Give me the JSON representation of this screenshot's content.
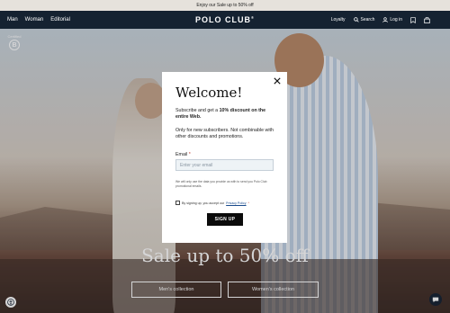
{
  "announcement": {
    "text": "Enjoy our Sale up to 50% off"
  },
  "nav": {
    "left_links": [
      "Man",
      "Woman",
      "Editorial"
    ],
    "logo": "POLO CLUB",
    "loyalty": "Loyalty",
    "search": "Search",
    "login": "Log in"
  },
  "badge": {
    "top": "Certified",
    "letter": "B"
  },
  "hero": {
    "headline": "Sale up to 50% off",
    "men_button": "Men's collection",
    "women_button": "Women's collection"
  },
  "modal": {
    "title": "Welcome!",
    "offer_prefix": "Subscribe and get a ",
    "offer_bold": "10% discount on the entire Web.",
    "note": "Only for new subscribers. Not combinable with other discounts and promotions.",
    "email_label": "Email",
    "email_required": "*",
    "email_placeholder": "Enter your email",
    "legal": "We will only use the data you provide us with to send you Polo Club promotional emails.",
    "consent_prefix": "By signing up, you accept our ",
    "consent_link": "Privacy Policy",
    "consent_required": "*",
    "signup_button": "SIGN UP"
  },
  "colors": {
    "nav_bg": "#152231",
    "announce_bg": "#e6e2dc",
    "button_bg": "#0b0b0b",
    "required": "#c0392b"
  },
  "icons": [
    "user-icon",
    "search-icon",
    "bookmark-icon",
    "bag-icon",
    "close-icon",
    "accessibility-icon",
    "chat-icon"
  ]
}
